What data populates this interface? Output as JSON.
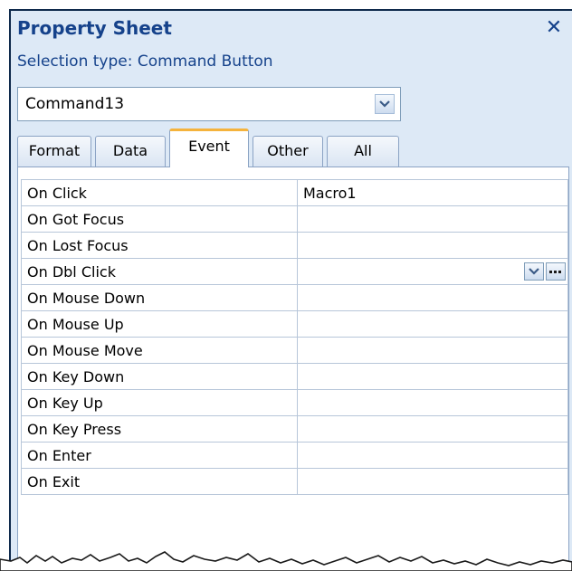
{
  "window": {
    "title": "Property Sheet",
    "close_glyph": "✕"
  },
  "selection": {
    "label": "Selection type:  Command Button"
  },
  "object_combo": {
    "value": "Command13"
  },
  "tabs": [
    {
      "label": "Format",
      "active": false
    },
    {
      "label": "Data",
      "active": false
    },
    {
      "label": "Event",
      "active": true
    },
    {
      "label": "Other",
      "active": false
    },
    {
      "label": "All",
      "active": false
    }
  ],
  "properties": [
    {
      "name": "On Click",
      "value": "Macro1"
    },
    {
      "name": "On Got Focus",
      "value": ""
    },
    {
      "name": "On Lost Focus",
      "value": ""
    },
    {
      "name": "On Dbl Click",
      "value": ""
    },
    {
      "name": "On Mouse Down",
      "value": ""
    },
    {
      "name": "On Mouse Up",
      "value": ""
    },
    {
      "name": "On Mouse Move",
      "value": ""
    },
    {
      "name": "On Key Down",
      "value": ""
    },
    {
      "name": "On Key Up",
      "value": ""
    },
    {
      "name": "On Key Press",
      "value": ""
    },
    {
      "name": "On Enter",
      "value": ""
    },
    {
      "name": "On Exit",
      "value": ""
    }
  ],
  "icons": {
    "dropdown": "chevron-down-icon",
    "builder": "ellipsis-icon",
    "close": "close-icon"
  },
  "colors": {
    "accent": "#15428b",
    "panel_bg": "#dde9f6",
    "active_tab_highlight": "#f5b33c",
    "grid_line": "#b7c6d9"
  }
}
